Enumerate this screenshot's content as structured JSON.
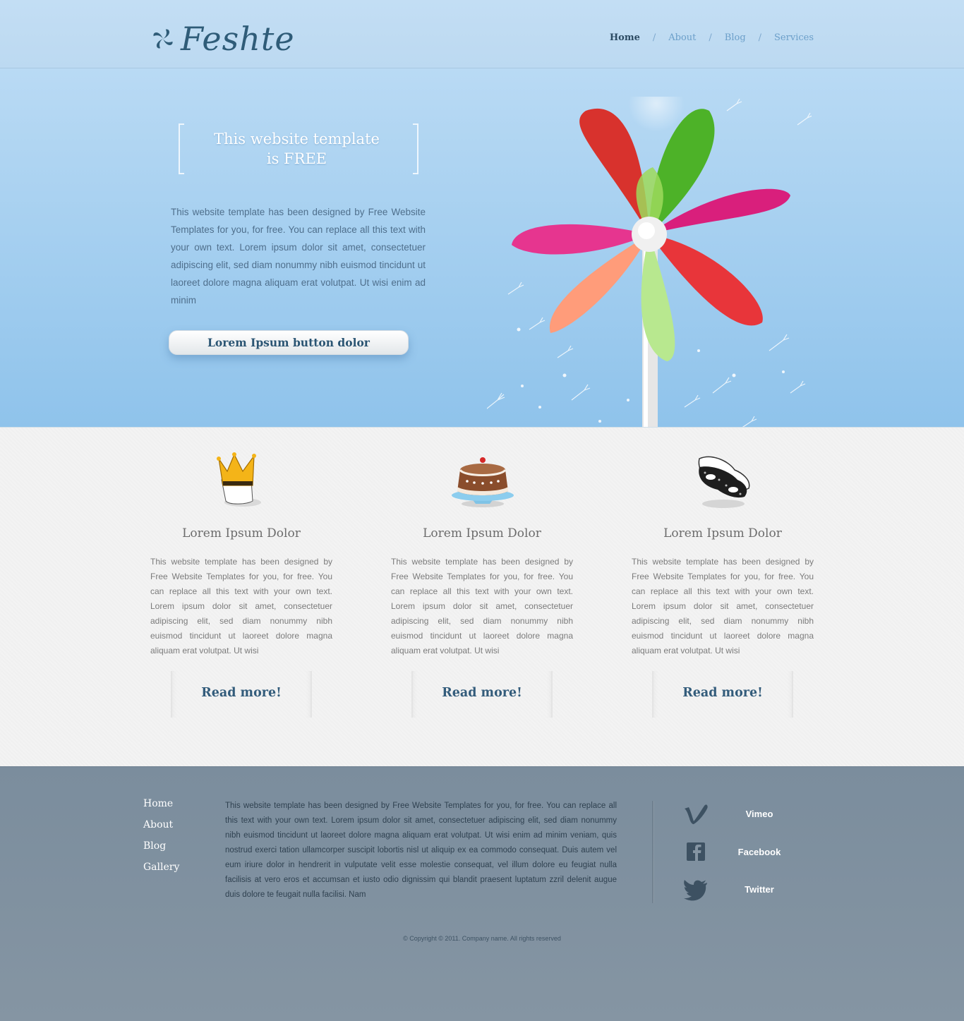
{
  "header": {
    "logo_text": "Feshte",
    "nav": [
      {
        "label": "Home",
        "active": true
      },
      {
        "label": "About",
        "active": false
      },
      {
        "label": "Blog",
        "active": false
      },
      {
        "label": "Services",
        "active": false
      }
    ],
    "nav_separator": "/"
  },
  "hero": {
    "title_line1": "This website template",
    "title_line2": "is FREE",
    "text": "This website template has been designed by Free Website Templates for you, for free. You can replace all this text with your own text. Lorem ipsum dolor sit amet, consectetuer adipiscing elit, sed diam nonummy nibh euismod tincidunt ut laoreet dolore magna aliquam erat volutpat. Ut wisi enim ad minim",
    "button_label": "Lorem Ipsum button dolor"
  },
  "features": [
    {
      "icon": "crown-icon",
      "title": "Lorem Ipsum Dolor",
      "text": "This website template has been designed by Free Website Templates for you, for free. You can replace all this text with your own text. Lorem ipsum dolor sit amet, consectetuer adipiscing elit, sed diam nonummy nibh euismod tincidunt ut laoreet dolore magna aliquam erat volutpat. Ut wisi",
      "button": "Read more!"
    },
    {
      "icon": "cake-icon",
      "title": "Lorem Ipsum Dolor",
      "text": "This website template has been designed by Free Website Templates for you, for free. You can replace all this text with your own text. Lorem ipsum dolor sit amet, consectetuer adipiscing elit, sed diam nonummy nibh euismod tincidunt ut laoreet dolore magna aliquam erat volutpat. Ut wisi",
      "button": "Read more!"
    },
    {
      "icon": "mask-icon",
      "title": "Lorem Ipsum Dolor",
      "text": "This website template has been designed by Free Website Templates for you, for free. You can replace all this text with your own text. Lorem ipsum dolor sit amet, consectetuer adipiscing elit, sed diam nonummy nibh euismod tincidunt ut laoreet dolore magna aliquam erat volutpat. Ut wisi",
      "button": "Read more!"
    }
  ],
  "footer": {
    "nav": [
      "Home",
      "About",
      "Blog",
      "Gallery"
    ],
    "text": "This website template has been designed by Free Website Templates for you, for free. You can replace all this text with your own text. Lorem ipsum dolor sit amet, consectetuer adipiscing elit, sed diam nonummy nibh euismod tincidunt ut laoreet dolore magna aliquam erat volutpat. Ut wisi enim ad minim veniam, quis nostrud exerci tation ullamcorper suscipit lobortis nisl ut aliquip ex ea commodo consequat. Duis autem vel eum iriure dolor in hendrerit in vulputate velit esse molestie consequat, vel illum dolore eu feugiat nulla facilisis at vero eros et accumsan et iusto odio dignissim qui blandit praesent luptatum zzril delenit augue duis dolore te feugait nulla facilisi. Nam",
    "social": [
      {
        "icon": "vimeo-icon",
        "label": "Vimeo"
      },
      {
        "icon": "facebook-icon",
        "label": "Facebook"
      },
      {
        "icon": "twitter-icon",
        "label": "Twitter"
      }
    ],
    "copyright": "© Copyright © 2011. Company name. All rights reserved"
  }
}
